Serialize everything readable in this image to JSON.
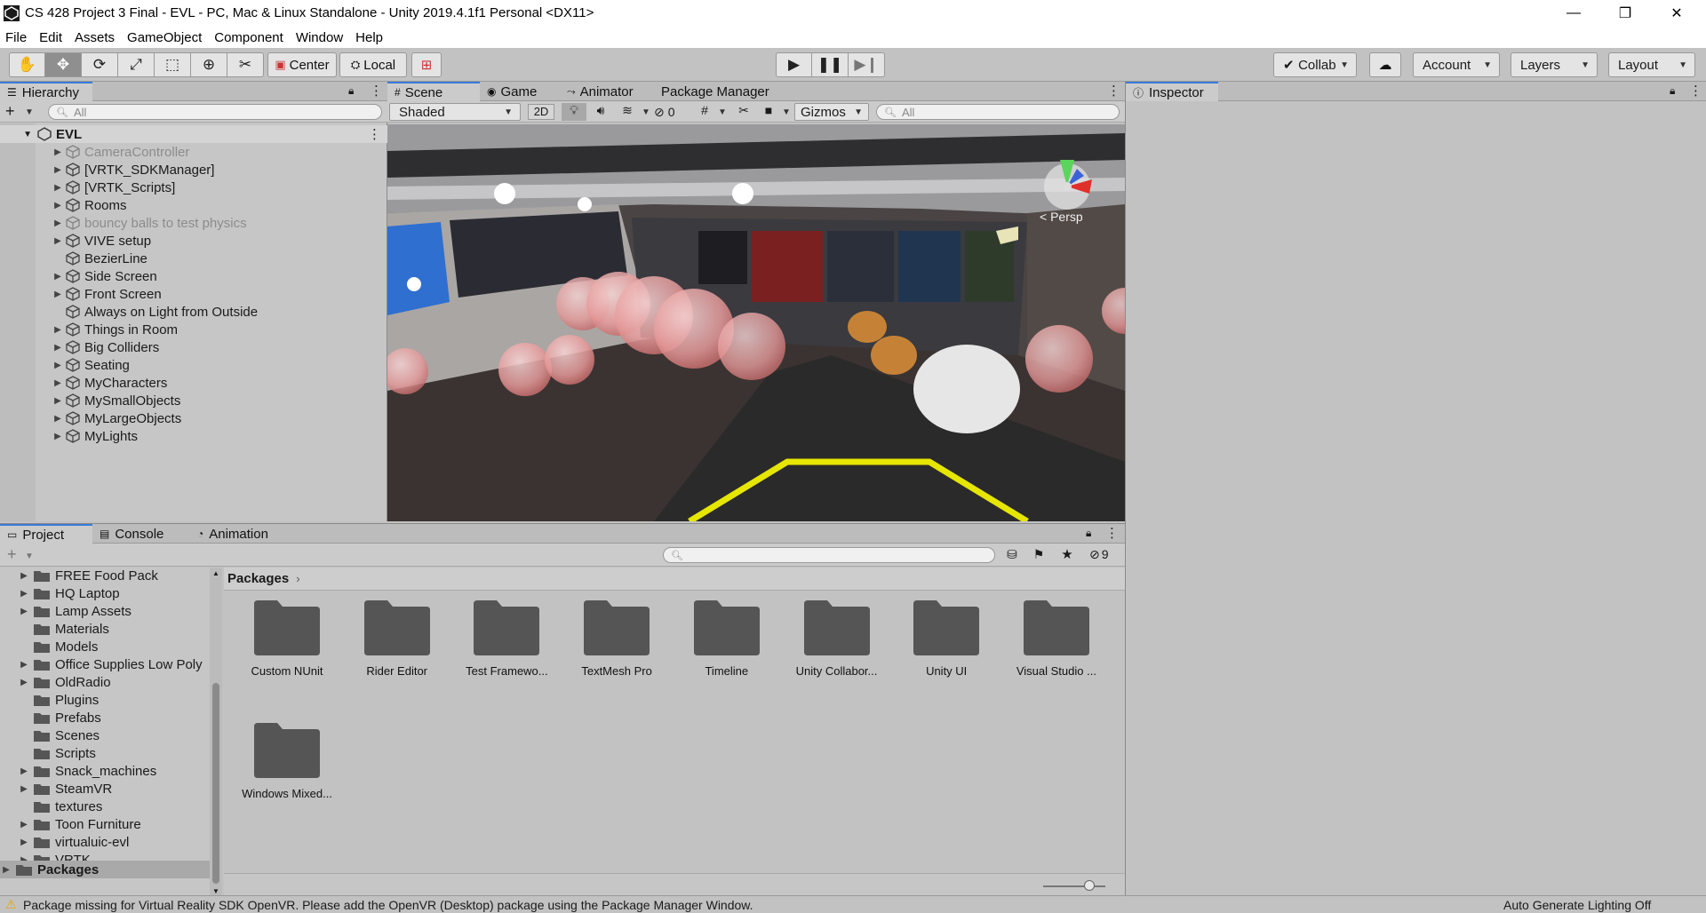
{
  "window": {
    "title": "CS 428 Project 3 Final - EVL - PC, Mac & Linux Standalone - Unity 2019.4.1f1 Personal <DX11>",
    "minimize": "—",
    "restore": "❐",
    "close": "✕"
  },
  "menu": [
    "File",
    "Edit",
    "Assets",
    "GameObject",
    "Component",
    "Window",
    "Help"
  ],
  "toolbar": {
    "tools": [
      "hand",
      "move",
      "rotate",
      "scale",
      "rect",
      "transform",
      "custom"
    ],
    "pivot_center": "Center",
    "pivot_local": "Local",
    "collab": "Collab",
    "account": "Account",
    "layers": "Layers",
    "layout": "Layout"
  },
  "hierarchy": {
    "tab": "Hierarchy",
    "search_placeholder": "All",
    "scene_name": "EVL",
    "items": [
      {
        "label": "CameraController",
        "expandable": true,
        "disabled": true
      },
      {
        "label": "[VRTK_SDKManager]",
        "expandable": true,
        "disabled": false
      },
      {
        "label": "[VRTK_Scripts]",
        "expandable": true,
        "disabled": false
      },
      {
        "label": "Rooms",
        "expandable": true,
        "disabled": false
      },
      {
        "label": "bouncy balls to test physics",
        "expandable": true,
        "disabled": true
      },
      {
        "label": "VIVE setup",
        "expandable": true,
        "disabled": false
      },
      {
        "label": "BezierLine",
        "expandable": false,
        "disabled": false
      },
      {
        "label": "Side Screen",
        "expandable": true,
        "disabled": false
      },
      {
        "label": "Front Screen",
        "expandable": true,
        "disabled": false
      },
      {
        "label": "Always on Light from Outside",
        "expandable": false,
        "disabled": false
      },
      {
        "label": "Things in Room",
        "expandable": true,
        "disabled": false
      },
      {
        "label": "Big Colliders",
        "expandable": true,
        "disabled": false
      },
      {
        "label": "Seating",
        "expandable": true,
        "disabled": false
      },
      {
        "label": "MyCharacters",
        "expandable": true,
        "disabled": false
      },
      {
        "label": "MySmallObjects",
        "expandable": true,
        "disabled": false
      },
      {
        "label": "MyLargeObjects",
        "expandable": true,
        "disabled": false
      },
      {
        "label": "MyLights",
        "expandable": true,
        "disabled": false
      }
    ]
  },
  "scene_tabs": [
    {
      "label": "Scene",
      "icon": "#",
      "active": true
    },
    {
      "label": "Game",
      "icon": "◉",
      "active": false
    },
    {
      "label": "Animator",
      "icon": "⤳",
      "active": false
    },
    {
      "label": "Package Manager",
      "icon": "",
      "active": false
    }
  ],
  "scene_toolbar": {
    "shading": "Shaded",
    "mode_2d": "2D",
    "hidden_count": "0",
    "gizmos": "Gizmos",
    "search_placeholder": "All",
    "persp": "< Persp"
  },
  "inspector": {
    "tab": "Inspector"
  },
  "bottom_tabs": [
    {
      "label": "Project",
      "active": true
    },
    {
      "label": "Console",
      "active": false
    },
    {
      "label": "Animation",
      "active": false
    }
  ],
  "project": {
    "hidden_count": "9",
    "breadcrumb": "Packages",
    "folders": [
      {
        "label": "FREE Food Pack",
        "expandable": true
      },
      {
        "label": "HQ Laptop",
        "expandable": true
      },
      {
        "label": "Lamp Assets",
        "expandable": true
      },
      {
        "label": "Materials",
        "expandable": false
      },
      {
        "label": "Models",
        "expandable": false
      },
      {
        "label": "Office Supplies Low Poly",
        "expandable": true
      },
      {
        "label": "OldRadio",
        "expandable": true
      },
      {
        "label": "Plugins",
        "expandable": false
      },
      {
        "label": "Prefabs",
        "expandable": false
      },
      {
        "label": "Scenes",
        "expandable": false
      },
      {
        "label": "Scripts",
        "expandable": false
      },
      {
        "label": "Snack_machines",
        "expandable": true
      },
      {
        "label": "SteamVR",
        "expandable": true
      },
      {
        "label": "textures",
        "expandable": false
      },
      {
        "label": "Toon Furniture",
        "expandable": true
      },
      {
        "label": "virtualuic-evl",
        "expandable": true
      },
      {
        "label": "VRTK",
        "expandable": true
      }
    ],
    "packages_root": "Packages",
    "assets": [
      "Custom NUnit",
      "Rider Editor",
      "Test Framewo...",
      "TextMesh Pro",
      "Timeline",
      "Unity Collabor...",
      "Unity UI",
      "Visual Studio ...",
      "Windows Mixed..."
    ]
  },
  "status": {
    "warning": "Package missing for Virtual Reality SDK OpenVR. Please add the OpenVR (Desktop) package using the Package Manager Window.",
    "right": "Auto Generate Lighting Off"
  },
  "colors": {
    "accent": "#3a7ad7",
    "panel": "#c2c2c2",
    "warning": "#e0a800"
  }
}
